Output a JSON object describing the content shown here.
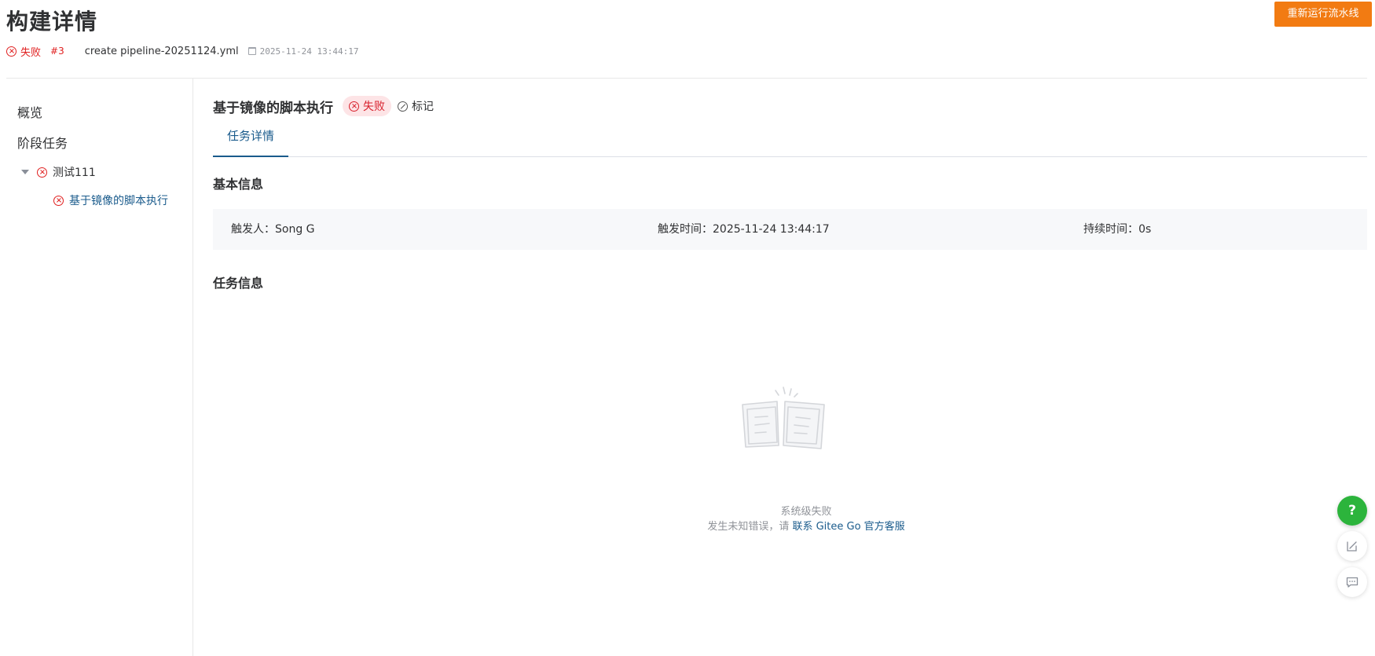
{
  "header": {
    "title": "构建详情",
    "status_label": "失败",
    "build_number": "#3",
    "pipeline_file": "create pipeline-20251124.yml",
    "created_time": "2025-11-24 13:44:17",
    "rerun_button": "重新运行流水线"
  },
  "sidebar": {
    "overview": "概览",
    "stage_tasks": "阶段任务",
    "stage_node": "测试111",
    "job_node": "基于镜像的脚本执行"
  },
  "job": {
    "title": "基于镜像的脚本执行",
    "status_label": "失败",
    "mark_label": "标记"
  },
  "tabs": [
    {
      "label": "任务详情",
      "active": true
    }
  ],
  "basic_info": {
    "section_title": "基本信息",
    "trigger_label": "触发人：",
    "trigger_value": "Song G",
    "trigger_time_label": "触发时间：",
    "trigger_time_value": "2025-11-24 13:44:17",
    "duration_label": "持续时间：",
    "duration_value": "0s"
  },
  "task_info": {
    "section_title": "任务信息"
  },
  "empty_state": {
    "title": "系统级失败",
    "desc_prefix": "发生未知错误，请",
    "link_text": "联系 Gitee Go 官方客服"
  },
  "floating": {
    "help_symbol": "?"
  },
  "colors": {
    "fail_red": "#e02020",
    "primary_orange": "#f27b12",
    "link_blue": "#1a5b8c",
    "help_green": "#2cb43c"
  }
}
